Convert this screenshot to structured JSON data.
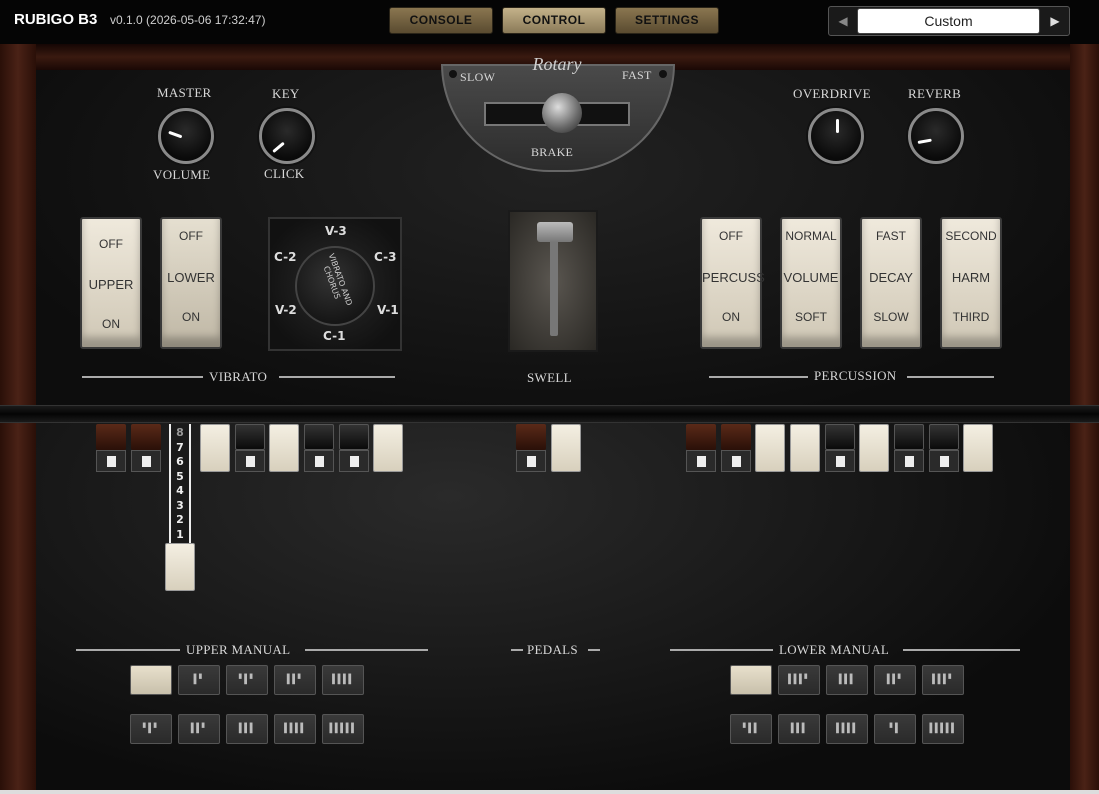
{
  "header": {
    "app_title": "RUBIGO B3",
    "version": "v0.1.0 (2026-05-06 17:32:47)",
    "tabs": [
      {
        "label": "CONSOLE",
        "active": false
      },
      {
        "label": "CONTROL",
        "active": true
      },
      {
        "label": "SETTINGS",
        "active": false
      }
    ],
    "preset": {
      "name": "Custom",
      "prev_icon": "triangle-left-icon",
      "next_icon": "triangle-right-icon"
    }
  },
  "knobs": {
    "master_top": "MASTER",
    "master_bottom": "VOLUME",
    "key_top": "KEY",
    "key_bottom": "CLICK",
    "overdrive": "OVERDRIVE",
    "reverb": "REVERB"
  },
  "rotary": {
    "title": "Rotary",
    "slow": "SLOW",
    "fast": "FAST",
    "brake": "BRAKE"
  },
  "vibrato": {
    "upper": {
      "off": "OFF",
      "name": "UPPER",
      "on": "ON"
    },
    "lower": {
      "off": "OFF",
      "name": "LOWER",
      "on": "ON"
    },
    "selector": {
      "v3": "V-3",
      "c2": "C-2",
      "c3": "C-3",
      "v2": "V-2",
      "v1": "V-1",
      "c1": "C-1",
      "center": "VIBRATO AND CHORUS"
    },
    "section_label": "VIBRATO"
  },
  "swell": {
    "label": "SWELL"
  },
  "percussion": {
    "switches": [
      {
        "top": "OFF",
        "name": "PERCUSS",
        "bottom": "ON"
      },
      {
        "top": "NORMAL",
        "name": "VOLUME",
        "bottom": "SOFT"
      },
      {
        "top": "FAST",
        "name": "DECAY",
        "bottom": "SLOW"
      },
      {
        "top": "SECOND",
        "name": "HARM",
        "bottom": "THIRD"
      }
    ],
    "section_label": "PERCUSSION"
  },
  "drawbar_scale": [
    "8",
    "7",
    "6",
    "5",
    "4",
    "3",
    "2",
    "1"
  ],
  "manuals": {
    "upper": "UPPER MANUAL",
    "pedals": "PEDALS",
    "lower": "LOWER MANUAL"
  }
}
